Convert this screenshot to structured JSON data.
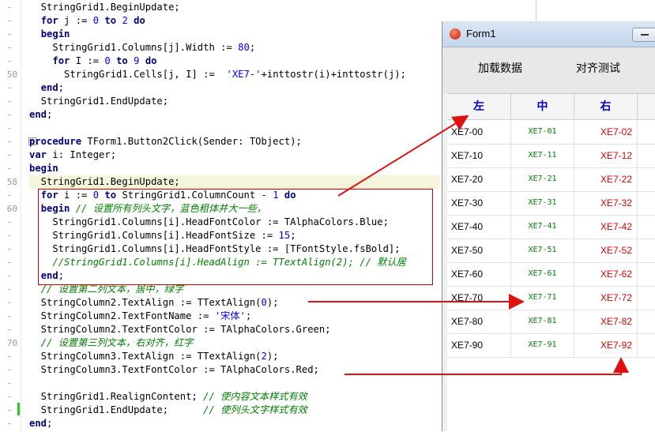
{
  "editor": {
    "gutter_numbers": [
      {
        "label": "50",
        "line": 5
      },
      {
        "label": "58",
        "line": 13
      },
      {
        "label": "60",
        "line": 15
      },
      {
        "label": "70",
        "line": 25
      }
    ],
    "lines": [
      [
        {
          "t": "  StringGrid1.BeginUpdate;"
        }
      ],
      [
        {
          "t": "  "
        },
        {
          "t": "for",
          "c": "kw"
        },
        {
          "t": " j := "
        },
        {
          "t": "0",
          "c": "num"
        },
        {
          "t": " "
        },
        {
          "t": "to",
          "c": "kw"
        },
        {
          "t": " "
        },
        {
          "t": "2",
          "c": "num"
        },
        {
          "t": " "
        },
        {
          "t": "do",
          "c": "kw"
        }
      ],
      [
        {
          "t": "  "
        },
        {
          "t": "begin",
          "c": "kw"
        }
      ],
      [
        {
          "t": "    StringGrid1.Columns[j].Width := "
        },
        {
          "t": "80",
          "c": "num"
        },
        {
          "t": ";"
        }
      ],
      [
        {
          "t": "    "
        },
        {
          "t": "for",
          "c": "kw"
        },
        {
          "t": " I := "
        },
        {
          "t": "0",
          "c": "num"
        },
        {
          "t": " "
        },
        {
          "t": "to",
          "c": "kw"
        },
        {
          "t": " "
        },
        {
          "t": "9",
          "c": "num"
        },
        {
          "t": " "
        },
        {
          "t": "do",
          "c": "kw"
        }
      ],
      [
        {
          "t": "      StringGrid1.Cells[j, I] :=  "
        },
        {
          "t": "'XE7-'",
          "c": "str"
        },
        {
          "t": "+inttostr(i)+inttostr(j);"
        }
      ],
      [
        {
          "t": "  "
        },
        {
          "t": "end",
          "c": "kw"
        },
        {
          "t": ";"
        }
      ],
      [
        {
          "t": "  StringGrid1.EndUpdate;"
        }
      ],
      [
        {
          "t": ""
        },
        {
          "t": "end",
          "c": "kw"
        },
        {
          "t": ";"
        }
      ],
      [
        {
          "t": ""
        }
      ],
      [
        {
          "t": "procedure",
          "c": "kw"
        },
        {
          "t": " TForm1.Button2Click(Sender: TObject);"
        }
      ],
      [
        {
          "t": ""
        },
        {
          "t": "var",
          "c": "kw"
        },
        {
          "t": " i: Integer;"
        }
      ],
      [
        {
          "t": ""
        },
        {
          "t": "begin",
          "c": "kw"
        }
      ],
      [
        {
          "t": "  StringGrid1.BeginUpdate;"
        }
      ],
      [
        {
          "t": "  "
        },
        {
          "t": "for",
          "c": "kw"
        },
        {
          "t": " i := "
        },
        {
          "t": "0",
          "c": "num"
        },
        {
          "t": " "
        },
        {
          "t": "to",
          "c": "kw"
        },
        {
          "t": " StringGrid1.ColumnCount - "
        },
        {
          "t": "1",
          "c": "num"
        },
        {
          "t": " "
        },
        {
          "t": "do",
          "c": "kw"
        }
      ],
      [
        {
          "t": "  "
        },
        {
          "t": "begin",
          "c": "kw"
        },
        {
          "t": " "
        },
        {
          "t": "// 设置所有列头文字，蓝色粗体并大一些，",
          "c": "cm"
        }
      ],
      [
        {
          "t": "    StringGrid1.Columns[i].HeadFontColor := TAlphaColors.Blue;"
        }
      ],
      [
        {
          "t": "    StringGrid1.Columns[i].HeadFontSize := "
        },
        {
          "t": "15",
          "c": "num"
        },
        {
          "t": ";"
        }
      ],
      [
        {
          "t": "    StringGrid1.Columns[i].HeadFontStyle := [TFontStyle.fsBold];"
        }
      ],
      [
        {
          "t": "    "
        },
        {
          "t": "//StringGrid1.Columns[i].HeadAlign := TTextAlign(2); // 默认居",
          "c": "cm"
        }
      ],
      [
        {
          "t": "  "
        },
        {
          "t": "end",
          "c": "kw"
        },
        {
          "t": ";"
        }
      ],
      [
        {
          "t": "  "
        },
        {
          "t": "// 设置第二列文本，居中，绿字",
          "c": "cm"
        }
      ],
      [
        {
          "t": "  StringColumn2.TextAlign := TTextAlign("
        },
        {
          "t": "0",
          "c": "num"
        },
        {
          "t": ");"
        }
      ],
      [
        {
          "t": "  StringColumn2.TextFontName := "
        },
        {
          "t": "'宋体'",
          "c": "str"
        },
        {
          "t": ";"
        }
      ],
      [
        {
          "t": "  StringColumn2.TextFontColor := TAlphaColors.Green;"
        }
      ],
      [
        {
          "t": "  "
        },
        {
          "t": "// 设置第三列文本，右对齐，红字",
          "c": "cm"
        }
      ],
      [
        {
          "t": "  StringColumn3.TextAlign := TTextAlign("
        },
        {
          "t": "2",
          "c": "num"
        },
        {
          "t": ");"
        }
      ],
      [
        {
          "t": "  StringColumn3.TextFontColor := TAlphaColors.Red;"
        }
      ],
      [
        {
          "t": ""
        }
      ],
      [
        {
          "t": "  StringGrid1.RealignContent; "
        },
        {
          "t": "// 使内容文本样式有效",
          "c": "cm"
        }
      ],
      [
        {
          "t": "  StringGrid1.EndUpdate;      "
        },
        {
          "t": "// 使列头文字样式有效",
          "c": "cm"
        }
      ],
      [
        {
          "t": ""
        },
        {
          "t": "end",
          "c": "kw"
        },
        {
          "t": ";"
        }
      ]
    ],
    "highlight_line": 13
  },
  "form": {
    "title": "Form1",
    "buttons": {
      "load": "加载数据",
      "align_test": "对齐测试"
    },
    "grid": {
      "headers": [
        "左",
        "中",
        "右"
      ],
      "rows": [
        [
          "XE7-00",
          "XE7-01",
          "XE7-02"
        ],
        [
          "XE7-10",
          "XE7-11",
          "XE7-12"
        ],
        [
          "XE7-20",
          "XE7-21",
          "XE7-22"
        ],
        [
          "XE7-30",
          "XE7-31",
          "XE7-32"
        ],
        [
          "XE7-40",
          "XE7-41",
          "XE7-42"
        ],
        [
          "XE7-50",
          "XE7-51",
          "XE7-52"
        ],
        [
          "XE7-60",
          "XE7-61",
          "XE7-62"
        ],
        [
          "XE7-70",
          "XE7-71",
          "XE7-72"
        ],
        [
          "XE7-80",
          "XE7-81",
          "XE7-82"
        ],
        [
          "XE7-90",
          "XE7-91",
          "XE7-92"
        ]
      ]
    }
  },
  "colors": {
    "header_text": "#0000cc",
    "col2_text": "#008000",
    "col3_text": "#dd0000",
    "annotation": "#dd1111"
  }
}
